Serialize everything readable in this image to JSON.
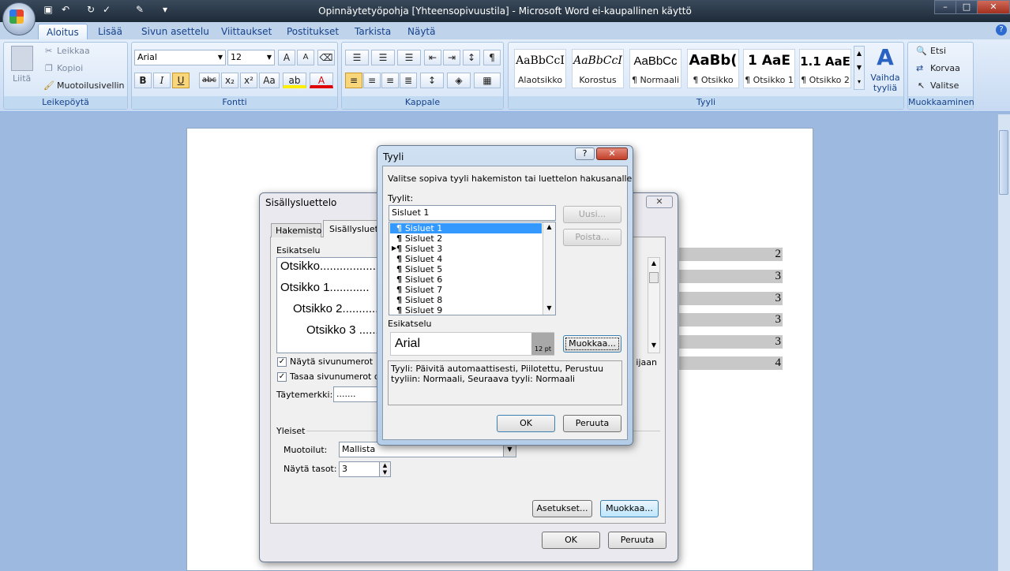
{
  "window": {
    "title": "Opinnäytetyöpohja [Yhteensopivuustila] - Microsoft Word ei-kaupallinen käyttö",
    "controls": [
      "–",
      "□",
      "✕"
    ]
  },
  "tabs": [
    "Aloitus",
    "Lisää",
    "Sivun asettelu",
    "Viittaukset",
    "Postitukset",
    "Tarkista",
    "Näytä"
  ],
  "ribbon": {
    "clipboard": {
      "label": "Leikepöytä",
      "paste": "Liitä",
      "cut": "Leikkaa",
      "copy": "Kopioi",
      "format_painter": "Muotoilusivellin"
    },
    "font": {
      "label": "Fontti",
      "family": "Arial",
      "size": "12",
      "bold": "B",
      "italic": "I",
      "underline": "U",
      "strike": "abc",
      "sub": "x₂",
      "sup": "x²",
      "case": "Aa"
    },
    "paragraph": {
      "label": "Kappale",
      "pilcrow": "¶"
    },
    "styles": {
      "label": "Tyyli",
      "change": "Vaihda tyyliä",
      "items": [
        {
          "sample": "AaBbCcI",
          "name": "Alaotsikko"
        },
        {
          "sample": "AaBbCcI",
          "name": "Korostus"
        },
        {
          "sample": "AaBbCc",
          "name": "¶ Normaali"
        },
        {
          "sample": "AaBb(",
          "name": "¶ Otsikko"
        },
        {
          "sample": "1  AaE",
          "name": "¶ Otsikko 1"
        },
        {
          "sample": "1.1  AaE",
          "name": "¶ Otsikko 2"
        }
      ]
    },
    "editing": {
      "label": "Muokkaaminen",
      "find": "Etsi",
      "replace": "Korvaa",
      "select": "Valitse"
    }
  },
  "document": {
    "toc_numbers": [
      "2",
      "3",
      "3",
      "3",
      "3",
      "4"
    ]
  },
  "toc_dialog": {
    "title": "Sisällysluettelo",
    "tabs": [
      "Hakemisto",
      "Sisällysluettelo"
    ],
    "preview_label": "Esikatselu",
    "preview_lines": [
      "Otsikko",
      "Otsikko 1",
      "Otsikko 2",
      "Otsikko 3"
    ],
    "show_page_numbers": "Näytä sivunumerot",
    "align_page_numbers": "Tasaa sivunumerot oike",
    "tab_leader_label": "Täytemerkki:",
    "tab_leader_value": ".......",
    "general": "Yleiset",
    "formats_label": "Muotoilut:",
    "formats_value": "Mallista",
    "levels_label": "Näytä tasot:",
    "levels_value": "3",
    "web_hint": "ijaan",
    "options_btn": "Asetukset...",
    "modify_btn": "Muokkaa...",
    "ok": "OK",
    "cancel": "Peruuta"
  },
  "style_dialog": {
    "title": "Tyyli",
    "instruction": "Valitse sopiva tyyli hakemiston tai luettelon hakusanalle",
    "styles_label": "Tyylit:",
    "style_input": "Sisluet 1",
    "styles": [
      "Sisluet 1",
      "Sisluet 2",
      "Sisluet 3",
      "Sisluet 4",
      "Sisluet 5",
      "Sisluet 6",
      "Sisluet 7",
      "Sisluet 8",
      "Sisluet 9"
    ],
    "new_btn": "Uusi...",
    "delete_btn": "Poista...",
    "preview_label": "Esikatselu",
    "preview_font": "Arial",
    "preview_size": "12 pt",
    "modify_btn": "Muokkaa...",
    "description": "Tyyli: Päivitä automaattisesti, Piilotettu, Perustuu tyyliin: Normaali, Seuraava tyyli: Normaali",
    "ok": "OK",
    "cancel": "Peruuta"
  }
}
